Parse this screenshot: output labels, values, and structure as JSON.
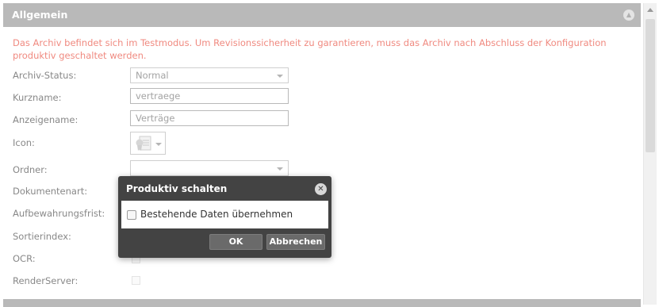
{
  "panel": {
    "title": "Allgemein",
    "collapse_icon": "chevron-up-icon"
  },
  "notice": "Das Archiv befindet sich im Testmodus. Um Revisionssicherheit zu garantieren, muss das Archiv nach Abschluss der Konfiguration produktiv geschaltet werden.",
  "form": {
    "status_label": "Archiv-Status:",
    "status_value": "Normal",
    "shortname_label": "Kurzname:",
    "shortname_value": "vertraege",
    "displayname_label": "Anzeigename:",
    "displayname_value": "Verträge",
    "icon_label": "Icon:",
    "icon_name": "certificate-document-icon",
    "folder_label": "Ordner:",
    "folder_value": "",
    "doctype_label": "Dokumentenart:",
    "retention_label": "Aufbewahrungsfrist:",
    "sortindex_label": "Sortierindex:",
    "ocr_label": "OCR:",
    "renderserver_label": "RenderServer:"
  },
  "modal": {
    "title": "Produktiv schalten",
    "close_icon": "close-icon",
    "checkbox_label": "Bestehende Daten übernehmen",
    "checkbox_checked": false,
    "ok_label": "OK",
    "cancel_label": "Abbrechen"
  },
  "colors": {
    "header_bg": "#b9b9b9",
    "notice_text": "#f08a80",
    "modal_bg": "#434343",
    "button_bg": "#6a6a6a"
  }
}
